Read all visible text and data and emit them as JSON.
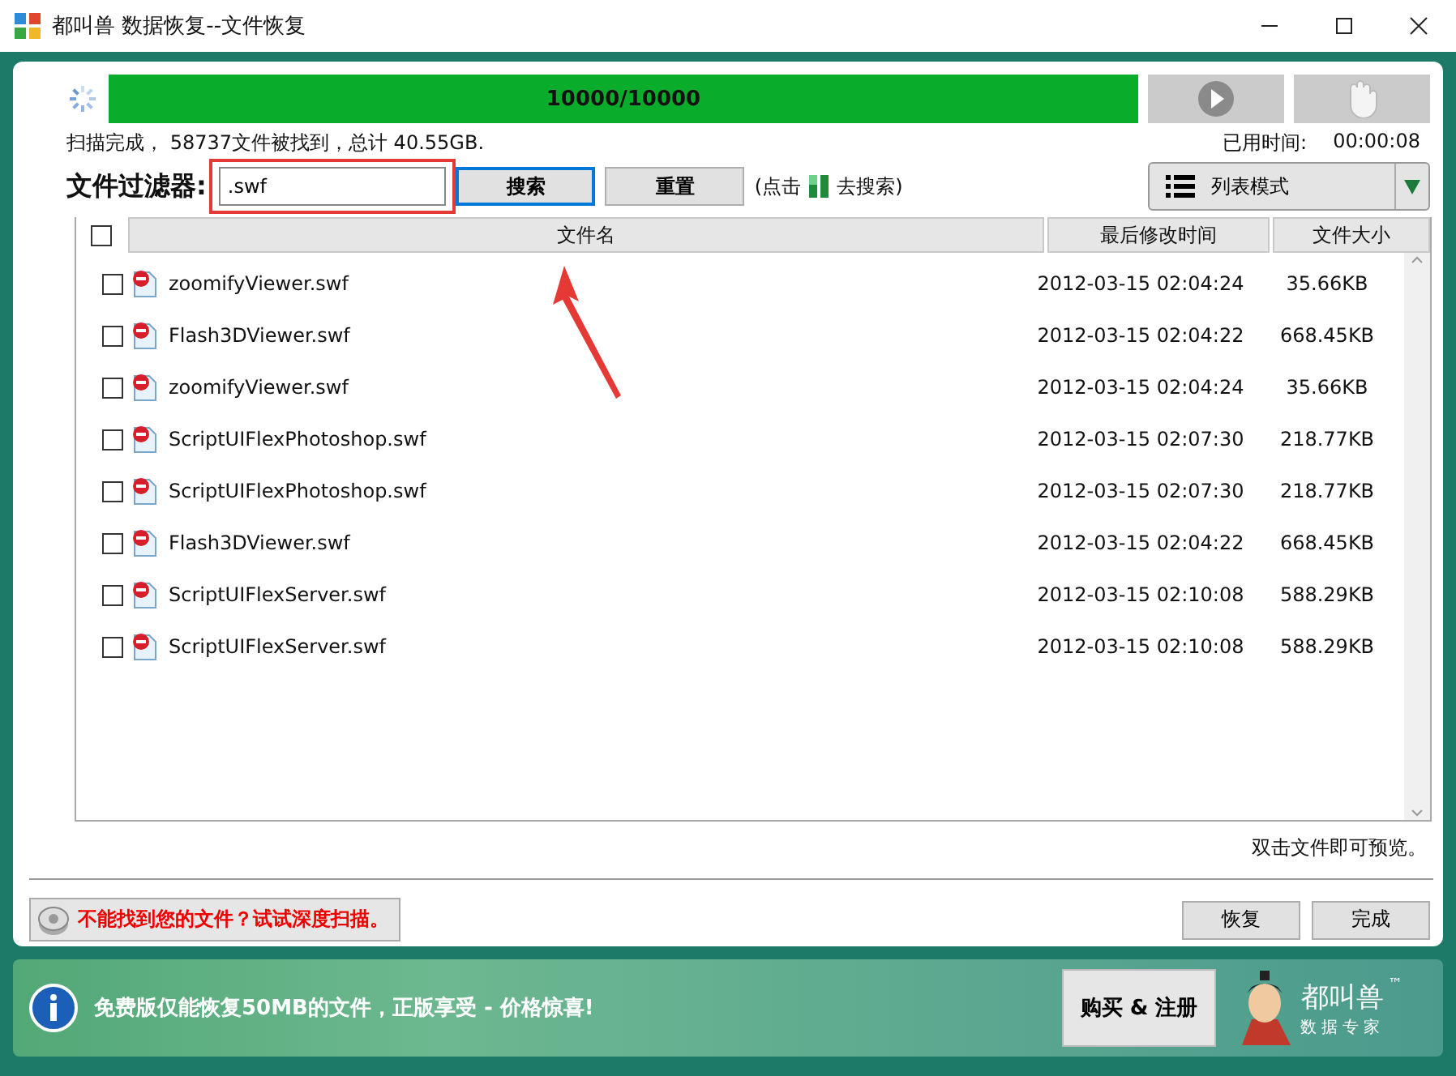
{
  "window": {
    "title": "都叫兽 数据恢复--文件恢复"
  },
  "progress": {
    "level": 1,
    "label": "10000/10000"
  },
  "scan_status": "扫描完成， 58737文件被找到，总计 40.55GB.",
  "elapsed": {
    "label": "已用时间:",
    "value": "00:00:08"
  },
  "filter": {
    "label": "文件过滤器:",
    "value": ".swf",
    "highlighted": true
  },
  "buttons": {
    "search": "搜索",
    "reset": "重置"
  },
  "hint": {
    "before": "(点击",
    "after": "去搜索)"
  },
  "view_mode": "列表模式",
  "table": {
    "columns": [
      "文件名",
      "最后修改时间",
      "文件大小"
    ],
    "all_checked": false,
    "rows": [
      {
        "name": "zoomifyViewer.swf",
        "modified": "2012-03-15 02:04:24",
        "size": "35.66KB",
        "checked": false
      },
      {
        "name": "Flash3DViewer.swf",
        "modified": "2012-03-15 02:04:22",
        "size": "668.45KB",
        "checked": false
      },
      {
        "name": "zoomifyViewer.swf",
        "modified": "2012-03-15 02:04:24",
        "size": "35.66KB",
        "checked": false
      },
      {
        "name": "ScriptUIFlexPhotoshop.swf",
        "modified": "2012-03-15 02:07:30",
        "size": "218.77KB",
        "checked": false
      },
      {
        "name": "ScriptUIFlexPhotoshop.swf",
        "modified": "2012-03-15 02:07:30",
        "size": "218.77KB",
        "checked": false
      },
      {
        "name": "Flash3DViewer.swf",
        "modified": "2012-03-15 02:04:22",
        "size": "668.45KB",
        "checked": false
      },
      {
        "name": "ScriptUIFlexServer.swf",
        "modified": "2012-03-15 02:10:08",
        "size": "588.29KB",
        "checked": false
      },
      {
        "name": "ScriptUIFlexServer.swf",
        "modified": "2012-03-15 02:10:08",
        "size": "588.29KB",
        "checked": false
      }
    ]
  },
  "preview_hint": "双击文件即可预览。",
  "deep_scan": "不能找到您的文件？试试深度扫描。",
  "actions": [
    "恢复",
    "完成"
  ],
  "promo": {
    "text": "免费版仅能恢复50MB的文件，正版享受 - 价格惊喜!",
    "button": "购买 & 注册"
  },
  "logo": {
    "name": "都叫兽",
    "tagline": "数据专家",
    "mark": "™"
  }
}
